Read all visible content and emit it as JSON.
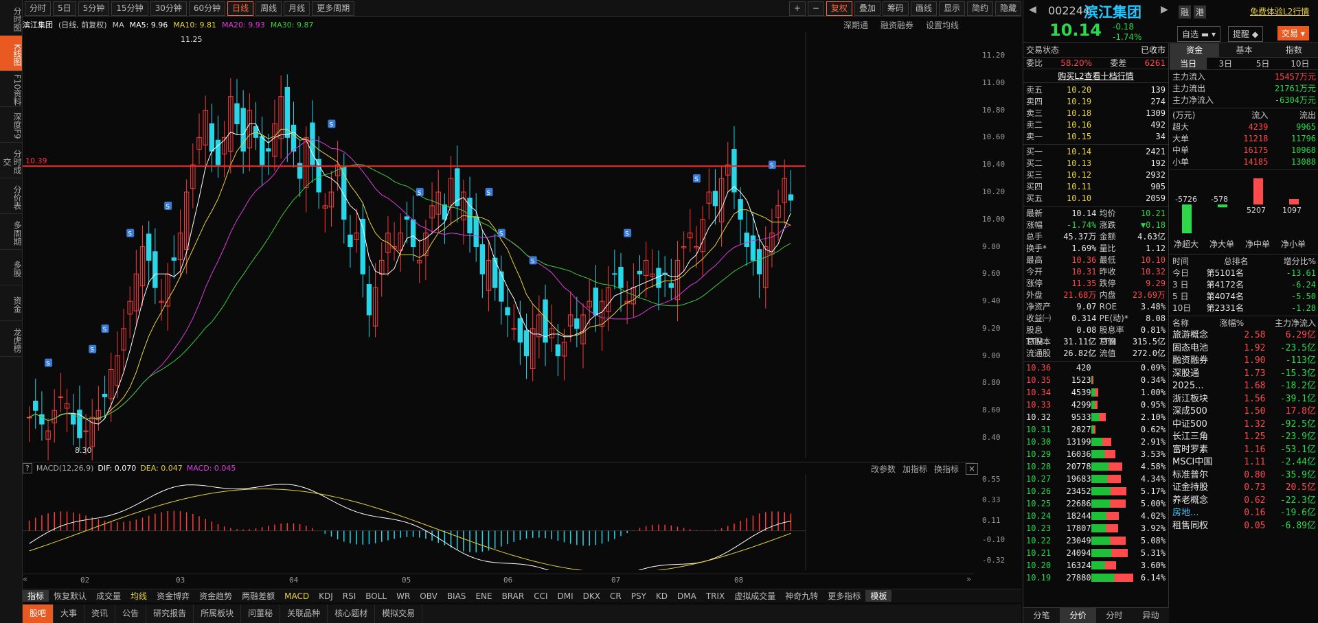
{
  "sidebar": {
    "items": [
      "分时图",
      "K线图",
      "F10资料",
      "深度F9",
      "分时成交",
      "分价表",
      "多周期",
      "多股",
      "资金",
      "龙虎榜"
    ]
  },
  "toolbar": {
    "periods": [
      "分时",
      "5日",
      "5分钟",
      "15分钟",
      "30分钟",
      "60分钟",
      "日线",
      "周线",
      "月线",
      "更多周期"
    ],
    "right": [
      "复权",
      "叠加",
      "筹码",
      "画线",
      "显示",
      "简约",
      "隐藏"
    ]
  },
  "stock": {
    "code": "002244",
    "name": "滨江集团",
    "price": "10.14",
    "change": "-0.18",
    "pct": "-1.74%",
    "chart_title": "滨江集团",
    "chart_sub": "(日线, 前复权)"
  },
  "ma": {
    "ma5": "MA5: 9.96",
    "ma10": "MA10: 9.81",
    "ma20": "MA20: 9.93",
    "ma30": "MA30: 9.87"
  },
  "topright_links": [
    "深期通",
    "融资融券",
    "设置均线"
  ],
  "yaxis": [
    "11.20",
    "11.00",
    "10.80",
    "10.60",
    "10.40",
    "10.20",
    "10.00",
    "9.80",
    "9.60",
    "9.40",
    "9.20",
    "9.00",
    "8.80",
    "8.60",
    "8.40"
  ],
  "yaxis_macd": [
    "0.55",
    "0.33",
    "0.11",
    "-0.10",
    "-0.32"
  ],
  "annot": {
    "high": "11.25",
    "low": "8.30",
    "line": "10.39"
  },
  "xaxis": [
    "02",
    "03",
    "04",
    "05",
    "06",
    "07",
    "08"
  ],
  "macd": {
    "name": "MACD(12,26,9)",
    "dif": "DIF: 0.070",
    "dea": "DEA: 0.047",
    "macd": "MACD: 0.045",
    "links": [
      "改参数",
      "加指标",
      "换指标"
    ]
  },
  "indicators": [
    "指标",
    "恢复默认",
    "成交量",
    "均线",
    "资金博弈",
    "资金趋势",
    "两融差额",
    "MACD",
    "KDJ",
    "RSI",
    "BOLL",
    "WR",
    "OBV",
    "BIAS",
    "ENE",
    "BRAR",
    "CCI",
    "DMI",
    "DKX",
    "CR",
    "PSY",
    "KD",
    "DMA",
    "TRIX",
    "虚拟成交量",
    "神奇九转",
    "更多指标",
    "模板"
  ],
  "bottom_tabs": [
    "股吧",
    "大事",
    "资讯",
    "公告",
    "研究报告",
    "所属板块",
    "问董秘",
    "关联品种",
    "核心题材",
    "模拟交易"
  ],
  "panel": {
    "toplinks": [
      "融",
      "港",
      "免费体验L2行情"
    ],
    "btns": [
      "自选",
      "提醒",
      "交易"
    ],
    "status_label": "交易状态",
    "status": "已收市",
    "weibi_label": "委比",
    "weibi": "58.20%",
    "weicha_label": "委差",
    "weicha": "6261",
    "buy_l2": "购买L2查看十档行情",
    "asks": [
      [
        "卖五",
        "10.20",
        "139"
      ],
      [
        "卖四",
        "10.19",
        "274"
      ],
      [
        "卖三",
        "10.18",
        "1309"
      ],
      [
        "卖二",
        "10.16",
        "492"
      ],
      [
        "卖一",
        "10.15",
        "34"
      ]
    ],
    "bids": [
      [
        "买一",
        "10.14",
        "2421"
      ],
      [
        "买二",
        "10.13",
        "192"
      ],
      [
        "买三",
        "10.12",
        "2932"
      ],
      [
        "买四",
        "10.11",
        "905"
      ],
      [
        "买五",
        "10.10",
        "2059"
      ]
    ],
    "stats": [
      [
        "最新",
        "10.14",
        "均价",
        "10.21"
      ],
      [
        "涨幅",
        "-1.74%",
        "涨跌",
        "▼0.18"
      ],
      [
        "总手",
        "45.37万",
        "金额",
        "4.63亿"
      ],
      [
        "换手*",
        "1.69%",
        "量比",
        "1.12"
      ],
      [
        "最高",
        "10.36",
        "最低",
        "10.10"
      ],
      [
        "今开",
        "10.31",
        "昨收",
        "10.32"
      ],
      [
        "涨停",
        "11.35",
        "跌停",
        "9.29"
      ],
      [
        "外盘",
        "21.68万",
        "内盘",
        "23.69万"
      ],
      [
        "净资产",
        "9.07",
        "ROE",
        "3.48%"
      ],
      [
        "收益㈠",
        "0.314",
        "PE(动)*",
        "8.08"
      ],
      [
        "股息TTM",
        "0.08",
        "股息率TTM",
        "0.81%"
      ],
      [
        "总股本",
        "31.11亿",
        "总值",
        "315.5亿"
      ],
      [
        "流通股",
        "26.82亿",
        "流值",
        "272.0亿"
      ]
    ],
    "pricevol": [
      [
        "10.36",
        "420",
        "0.09%"
      ],
      [
        "10.35",
        "1523",
        "0.34%"
      ],
      [
        "10.34",
        "4539",
        "1.00%"
      ],
      [
        "10.33",
        "4299",
        "0.95%"
      ],
      [
        "10.32",
        "9533",
        "2.10%"
      ],
      [
        "10.31",
        "2827",
        "0.62%"
      ],
      [
        "10.30",
        "13199",
        "2.91%"
      ],
      [
        "10.29",
        "16036",
        "3.53%"
      ],
      [
        "10.28",
        "20778",
        "4.58%"
      ],
      [
        "10.27",
        "19683",
        "4.34%"
      ],
      [
        "10.26",
        "23452",
        "5.17%"
      ],
      [
        "10.25",
        "22686",
        "5.00%"
      ],
      [
        "10.24",
        "18244",
        "4.02%"
      ],
      [
        "10.23",
        "17807",
        "3.92%"
      ],
      [
        "10.22",
        "23049",
        "5.08%"
      ],
      [
        "10.21",
        "24094",
        "5.31%"
      ],
      [
        "10.20",
        "16324",
        "3.60%"
      ],
      [
        "10.19",
        "27880",
        "6.14%"
      ]
    ],
    "bottomtabs": [
      "分笔",
      "分价",
      "分时",
      "异动"
    ],
    "fundtabs": [
      "资金",
      "基本",
      "指数"
    ],
    "daytabs": [
      "当日",
      "3日",
      "5日",
      "10日"
    ],
    "flow": [
      [
        "主力流入",
        "15457万元"
      ],
      [
        "主力流出",
        "21761万元"
      ],
      [
        "主力净流入",
        "-6304万元"
      ]
    ],
    "flowhdr": [
      "(万元)",
      "流入",
      "流出"
    ],
    "flowtbl": [
      [
        "超大",
        "4239",
        "9965"
      ],
      [
        "大单",
        "11218",
        "11796"
      ],
      [
        "中单",
        "16175",
        "10968"
      ],
      [
        "小单",
        "14185",
        "13088"
      ]
    ],
    "netbars": [
      [
        "-5726",
        "净超大"
      ],
      [
        "-578",
        "净大单"
      ],
      [
        "5207",
        "净中单"
      ],
      [
        "1097",
        "净小单"
      ]
    ],
    "rankhdr": [
      "时间",
      "总排名",
      "增分比%"
    ],
    "ranks": [
      [
        "今日",
        "第5101名",
        "-13.61"
      ],
      [
        "3 日",
        "第4172名",
        "-6.24"
      ],
      [
        "5 日",
        "第4074名",
        "-5.50"
      ],
      [
        "10日",
        "第2331名",
        "-1.28"
      ]
    ],
    "sechdr": [
      "名称",
      "涨幅%",
      "主力净流入"
    ],
    "sectors": [
      [
        "旅游概念",
        "2.58",
        "6.29亿"
      ],
      [
        "固态电池",
        "1.92",
        "-23.5亿"
      ],
      [
        "融资融券",
        "1.90",
        "-113亿"
      ],
      [
        "深股通",
        "1.73",
        "-15.3亿"
      ],
      [
        "2025...",
        "1.68",
        "-18.2亿"
      ],
      [
        "浙江板块",
        "1.56",
        "-39.1亿"
      ],
      [
        "深成500",
        "1.50",
        "17.8亿"
      ],
      [
        "中证500",
        "1.32",
        "-92.5亿"
      ],
      [
        "长江三角",
        "1.25",
        "-23.9亿"
      ],
      [
        "富时罗素",
        "1.16",
        "-53.1亿"
      ],
      [
        "MSCI中国",
        "1.11",
        "-2.44亿"
      ],
      [
        "标准普尔",
        "0.80",
        "-35.9亿"
      ],
      [
        "证金持股",
        "0.73",
        "20.5亿"
      ],
      [
        "养老概念",
        "0.62",
        "-22.3亿"
      ],
      [
        "房地...",
        "0.16",
        "-19.6亿"
      ],
      [
        "租售同权",
        "0.05",
        "-6.89亿"
      ]
    ]
  }
}
